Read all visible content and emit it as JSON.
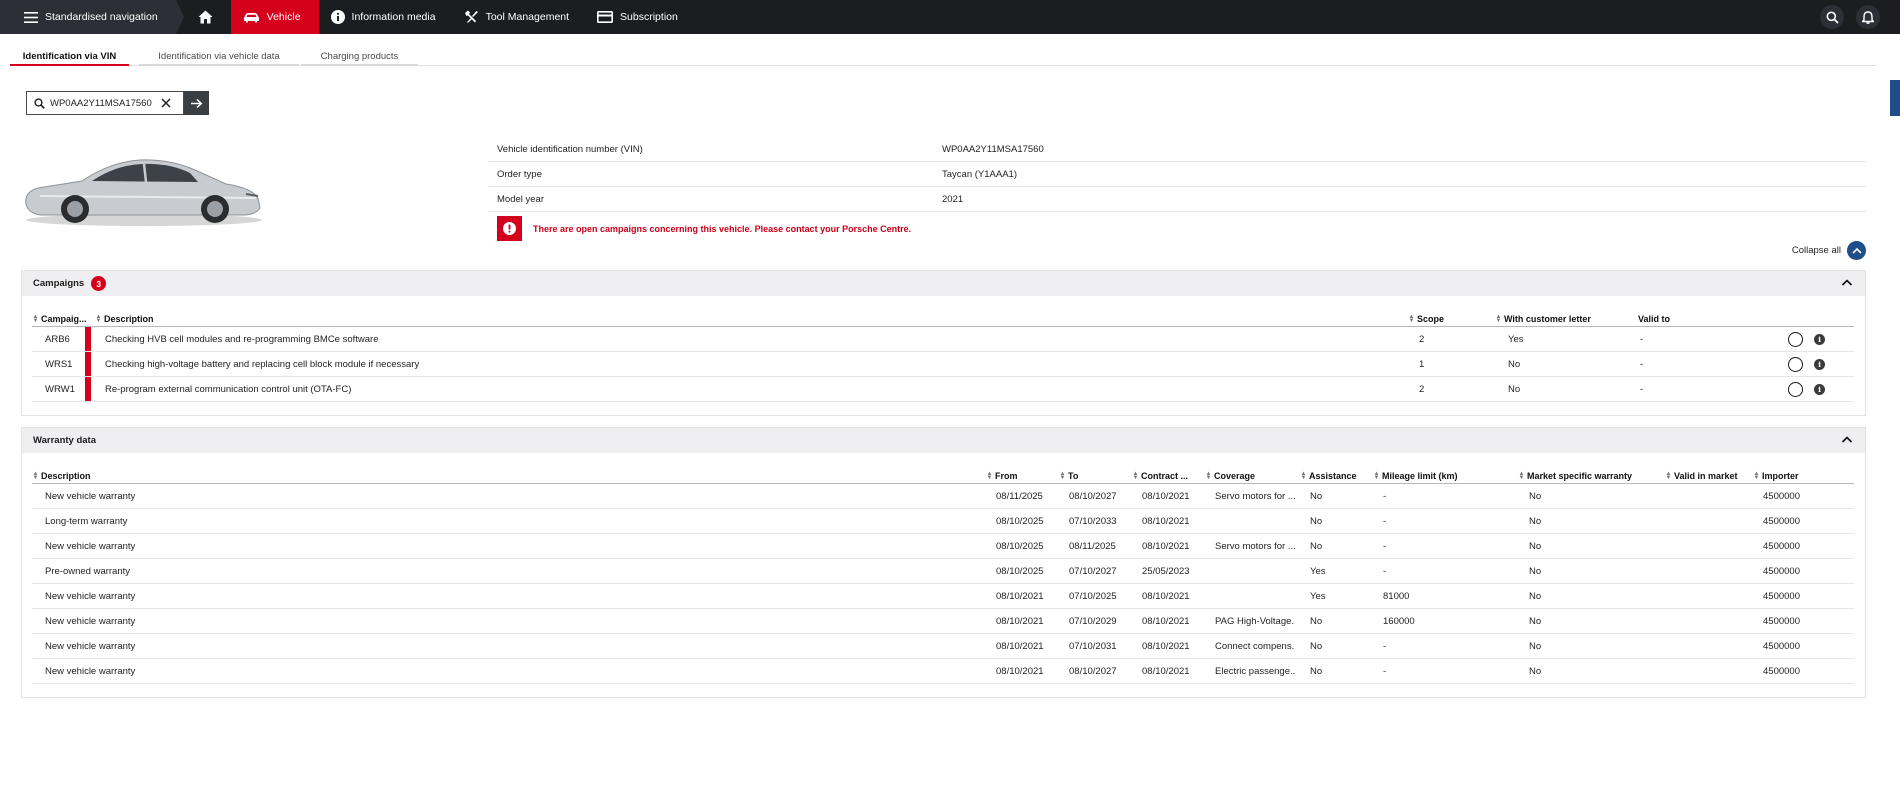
{
  "nav": {
    "standardised": "Standardised navigation",
    "vehicle": "Vehicle",
    "information_media": "Information media",
    "tool_management": "Tool Management",
    "subscription": "Subscription"
  },
  "tabs": [
    "Identification via VIN",
    "Identification via vehicle data",
    "Charging products"
  ],
  "search": {
    "value": "WP0AA2Y11MSA17560"
  },
  "vehicle": {
    "rows": [
      {
        "label": "Vehicle identification number (VIN)",
        "value": "WP0AA2Y11MSA17560"
      },
      {
        "label": "Order type",
        "value": "Taycan (Y1AAA1)"
      },
      {
        "label": "Model year",
        "value": "2021"
      }
    ],
    "alert": "There are open campaigns concerning this vehicle. Please contact your Porsche Centre.",
    "collapse_all": "Collapse all"
  },
  "campaigns": {
    "title": "Campaigns",
    "count": "3",
    "headers": [
      "Campaig...",
      "Description",
      "Scope",
      "With customer letter",
      "Valid to"
    ],
    "rows": [
      [
        "ARB6",
        "Checking HVB cell modules and re-programming BMCe software",
        "2",
        "Yes",
        "-"
      ],
      [
        "WRS1",
        "Checking high-voltage battery and replacing cell block module if necessary",
        "1",
        "No",
        "-"
      ],
      [
        "WRW1",
        "Re-program external communication control unit (OTA-FC)",
        "2",
        "No",
        "-"
      ]
    ]
  },
  "warranty": {
    "title": "Warranty data",
    "headers": [
      "Description",
      "From",
      "To",
      "Contract ...",
      "Coverage",
      "Assistance",
      "Mileage limit (km)",
      "Market specific warranty",
      "Valid in market",
      "Importer"
    ],
    "rows": [
      [
        "New vehicle warranty",
        "08/11/2025",
        "08/10/2027",
        "08/10/2021",
        "Servo motors for ...",
        "No",
        "-",
        "No",
        "",
        "4500000"
      ],
      [
        "Long-term warranty",
        "08/10/2025",
        "07/10/2033",
        "08/10/2021",
        "",
        "No",
        "-",
        "No",
        "",
        "4500000"
      ],
      [
        "New vehicle warranty",
        "08/10/2025",
        "08/11/2025",
        "08/10/2021",
        "Servo motors for ...",
        "No",
        "-",
        "No",
        "",
        "4500000"
      ],
      [
        "Pre-owned warranty",
        "08/10/2025",
        "07/10/2027",
        "25/05/2023",
        "",
        "Yes",
        "-",
        "No",
        "",
        "4500000"
      ],
      [
        "New vehicle warranty",
        "08/10/2021",
        "07/10/2025",
        "08/10/2021",
        "",
        "Yes",
        "81000",
        "No",
        "",
        "4500000"
      ],
      [
        "New vehicle warranty",
        "08/10/2021",
        "07/10/2029",
        "08/10/2021",
        "PAG High-Voltage...",
        "No",
        "160000",
        "No",
        "",
        "4500000"
      ],
      [
        "New vehicle warranty",
        "08/10/2021",
        "07/10/2031",
        "08/10/2021",
        "Connect compens...",
        "No",
        "-",
        "No",
        "",
        "4500000"
      ],
      [
        "New vehicle warranty",
        "08/10/2021",
        "08/10/2027",
        "08/10/2021",
        "Electric passenge...",
        "No",
        "-",
        "No",
        "",
        "4500000"
      ]
    ]
  },
  "colors": {
    "brand_red": "#d5001c",
    "nav_bg": "#1b1d21",
    "accent_blue": "#1e4d87"
  }
}
